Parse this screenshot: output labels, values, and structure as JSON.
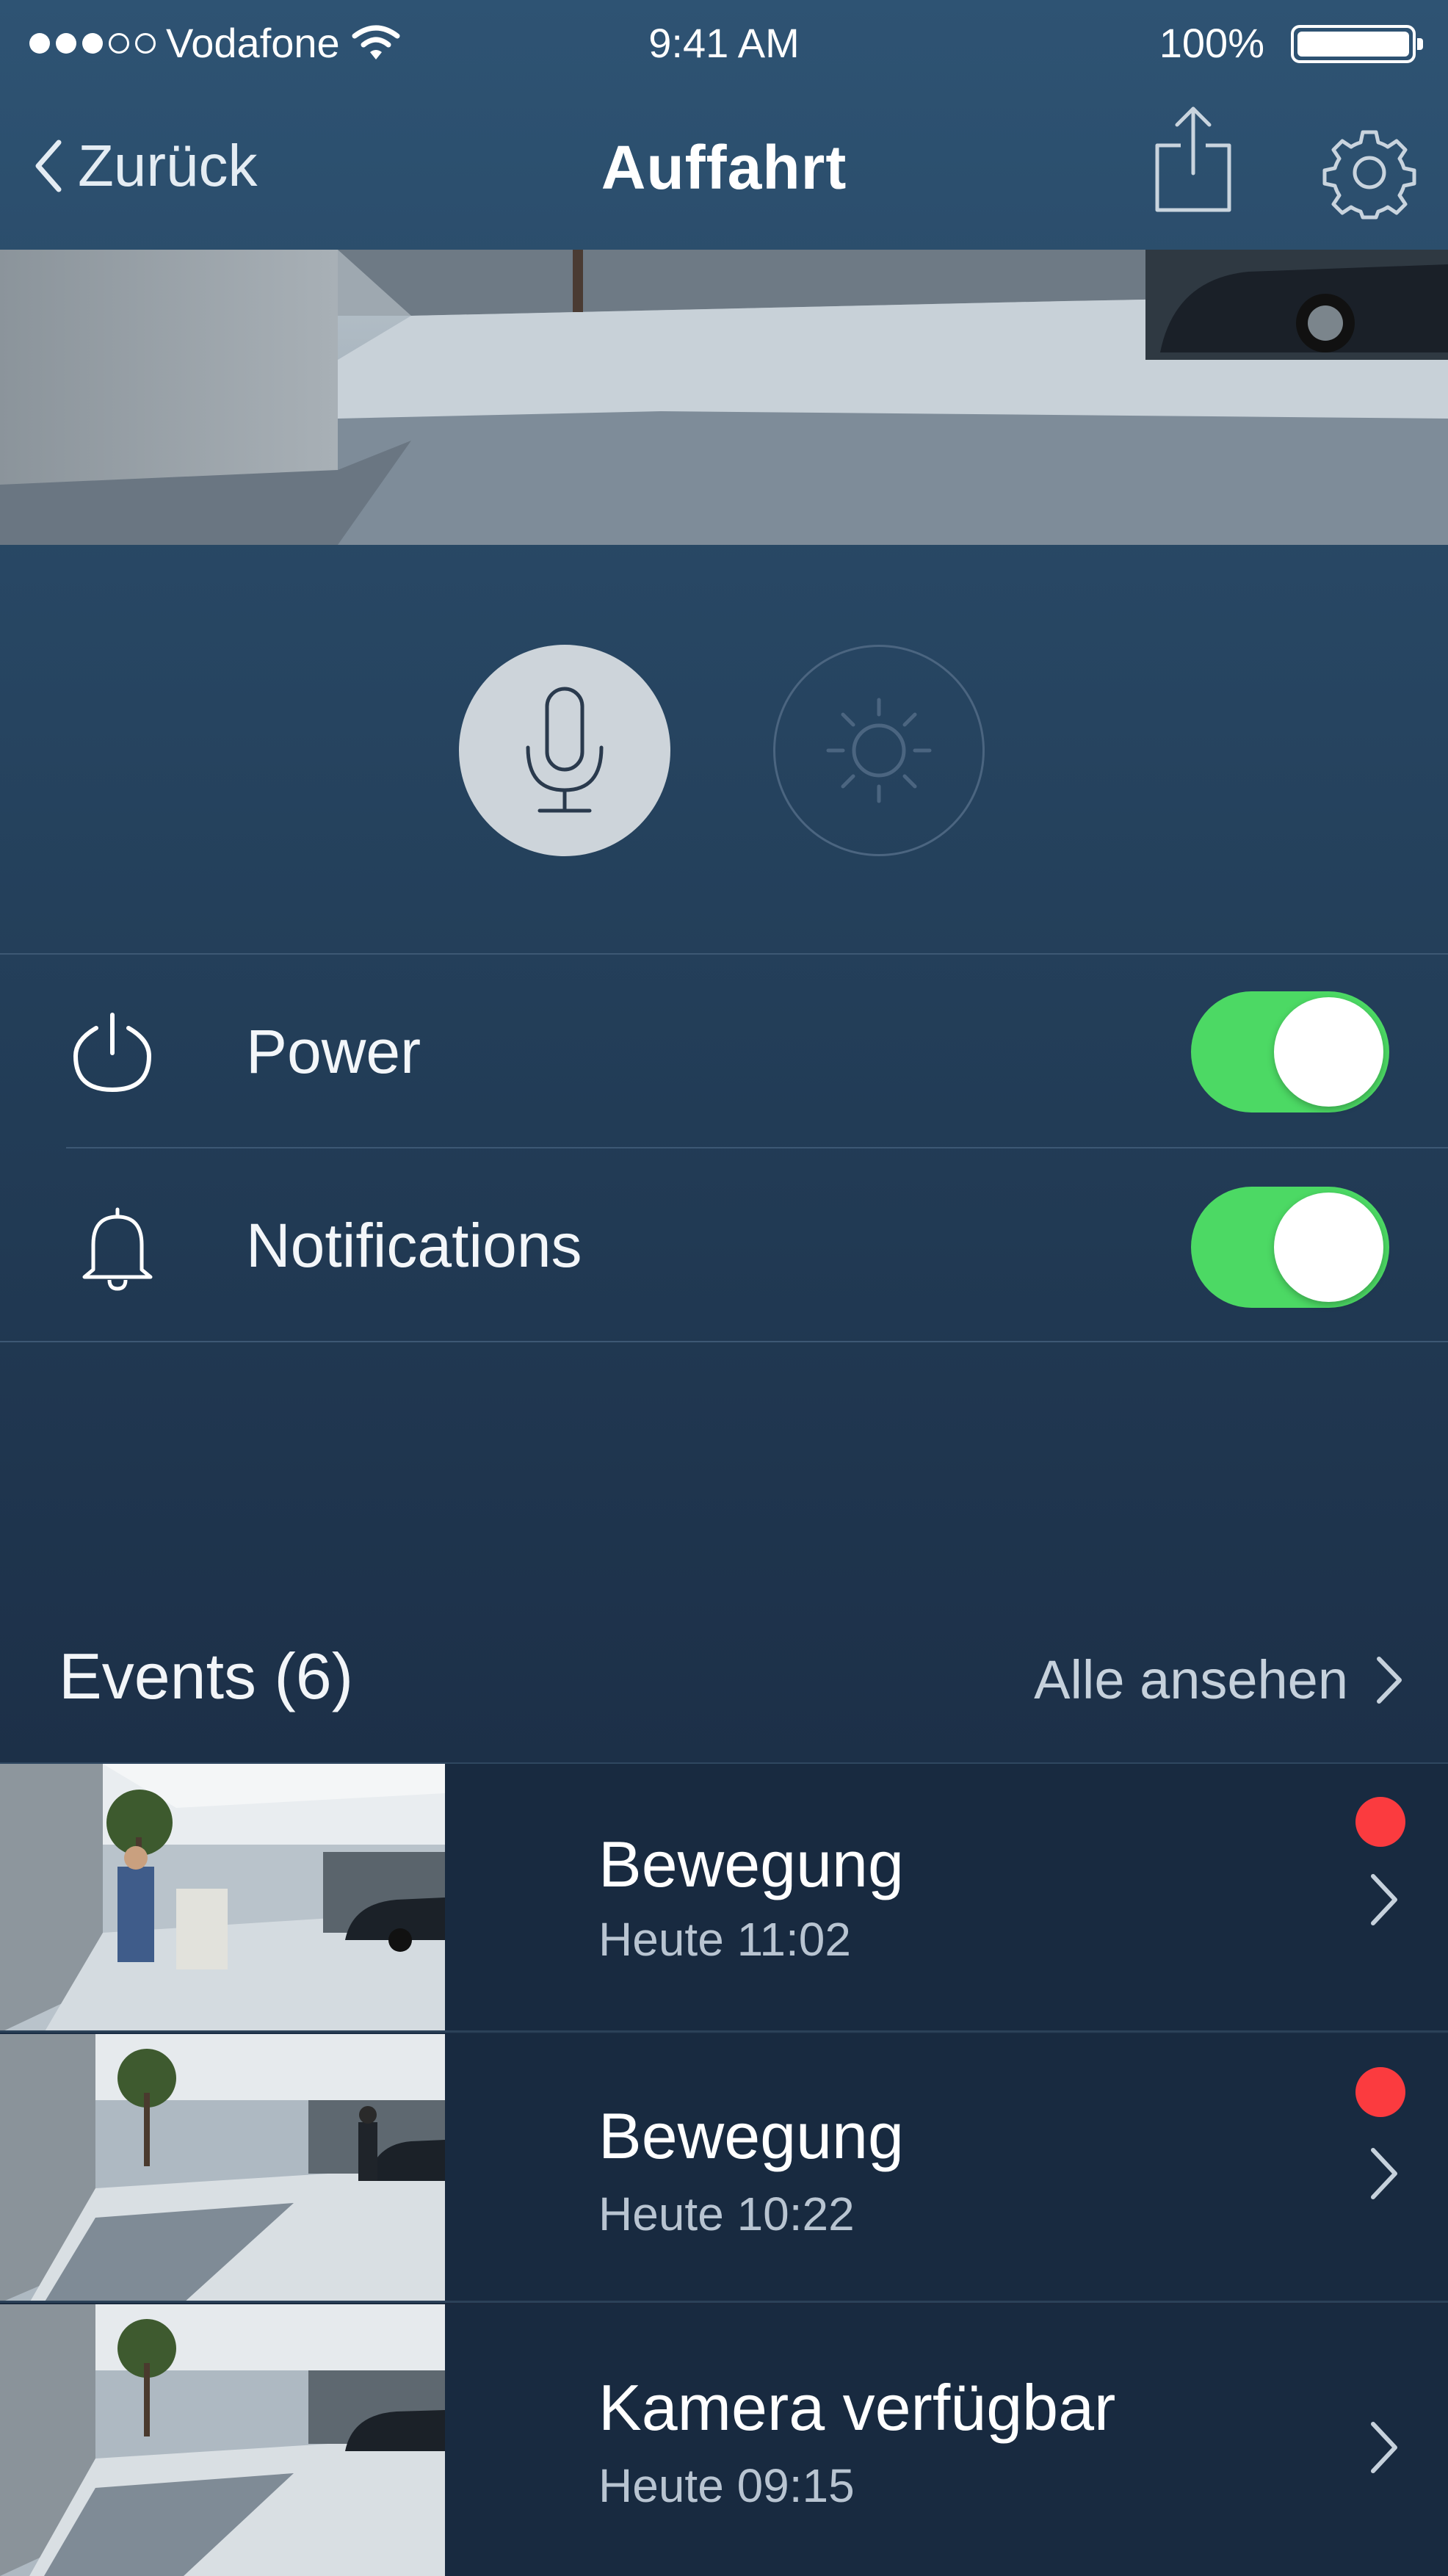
{
  "status_bar": {
    "carrier": "Vodafone",
    "time": "9:41 AM",
    "battery": "100%"
  },
  "nav": {
    "back_label": "Zurück",
    "title": "Auffahrt",
    "share_icon": "share-icon",
    "settings_icon": "gear-icon"
  },
  "controls": {
    "mic_icon": "microphone-icon",
    "light_icon": "light-icon",
    "mic_active": true,
    "light_active": false
  },
  "settings": [
    {
      "icon": "power-icon",
      "label": "Power",
      "enabled": true
    },
    {
      "icon": "bell-icon",
      "label": "Notifications",
      "enabled": true
    }
  ],
  "events": {
    "header": "Events (6)",
    "see_all": "Alle ansehen",
    "items": [
      {
        "title": "Bewegung",
        "time": "Heute 11:02",
        "unread": true
      },
      {
        "title": "Bewegung",
        "time": "Heute 10:22",
        "unread": true
      },
      {
        "title": "Kamera verfügbar",
        "time": "Heute 09:15",
        "unread": false
      }
    ]
  },
  "colors": {
    "toggle_on": "#4cd964",
    "badge_red": "#fb3b3f",
    "background_top": "#2e5373",
    "background_bottom": "#17263a"
  }
}
